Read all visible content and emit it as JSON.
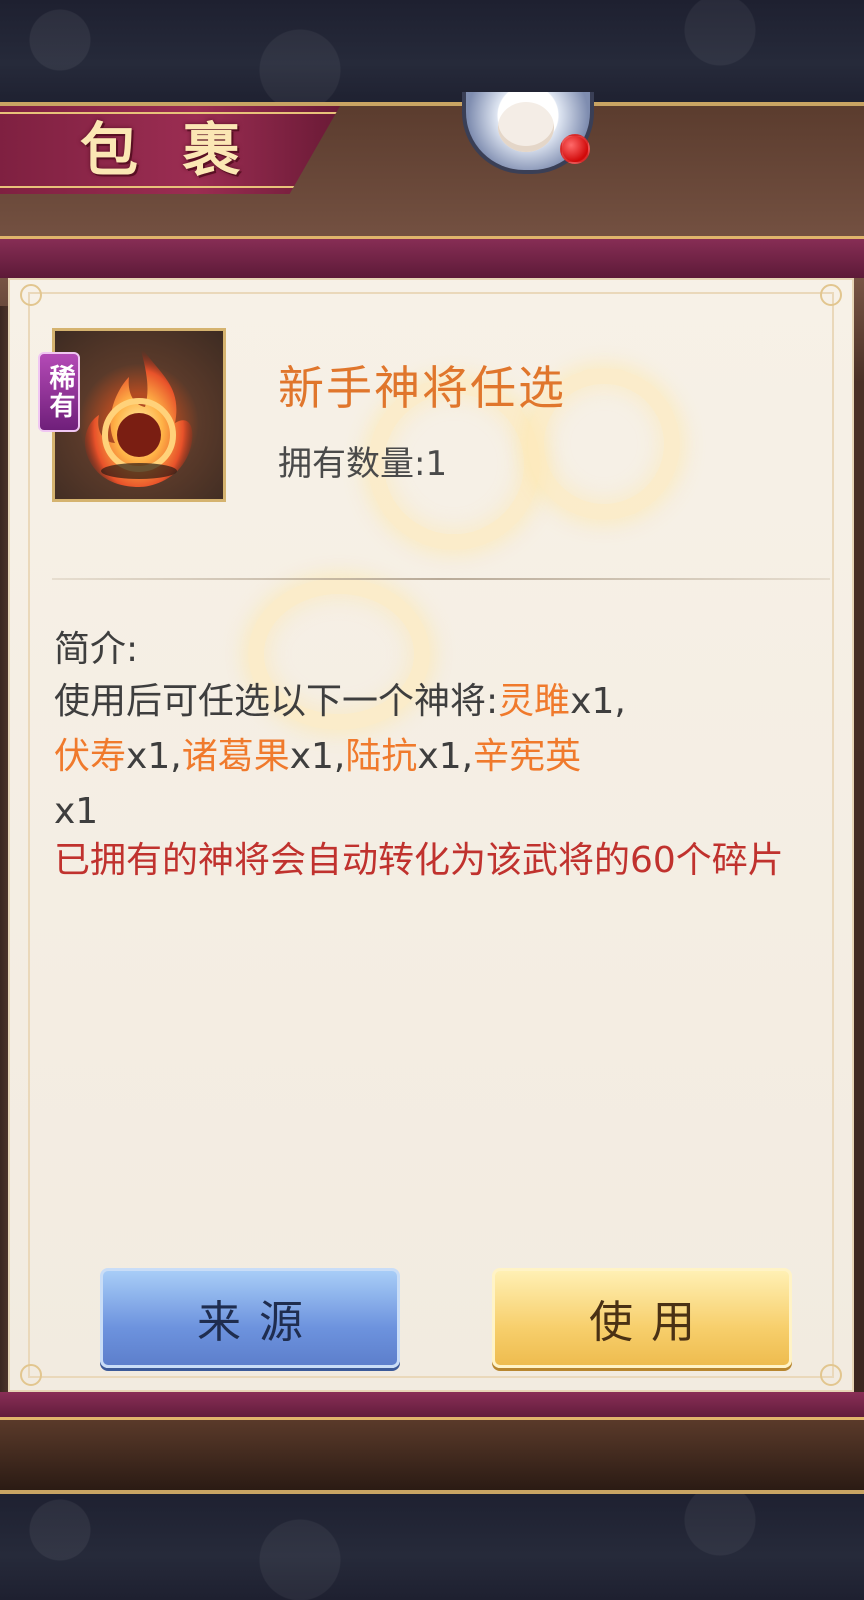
{
  "header": {
    "title": "包 裹"
  },
  "item": {
    "badge": "稀有",
    "name": "新手神将任选",
    "owned_label": "拥有数量:",
    "owned_count": "1"
  },
  "description": {
    "label": "简介:",
    "intro": "使用后可任选以下一个神将:",
    "options": [
      {
        "name": "灵雎",
        "qty": "x1",
        "sep": ","
      },
      {
        "name": "伏寿",
        "qty": "x1",
        "sep": ","
      },
      {
        "name": "诸葛果",
        "qty": "x1",
        "sep": ","
      },
      {
        "name": "陆抗",
        "qty": "x1",
        "sep": ","
      },
      {
        "name": "辛宪英",
        "qty": "x1",
        "sep": ""
      }
    ],
    "note": "已拥有的神将会自动转化为该武将的60个碎片"
  },
  "buttons": {
    "source": "来源",
    "use": "使用"
  },
  "colors": {
    "highlight": "#f07a2c",
    "note_red": "#c0322e",
    "item_name": "#e0762c",
    "rare_badge": "#8a2a94"
  },
  "notification": {
    "has_dot": true
  }
}
